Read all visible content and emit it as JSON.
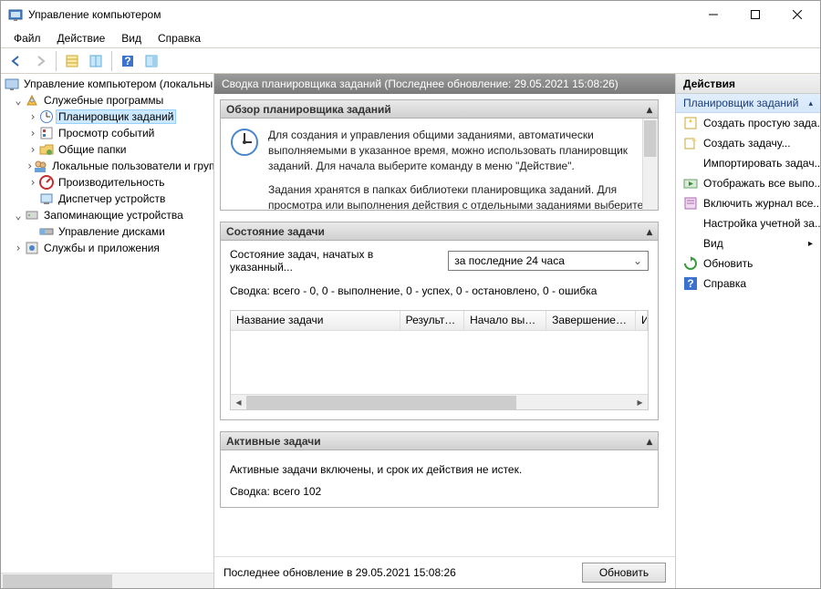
{
  "title": "Управление компьютером",
  "menu": {
    "file": "Файл",
    "action": "Действие",
    "view": "Вид",
    "help": "Справка"
  },
  "tree": {
    "root": "Управление компьютером (локальным",
    "utilities": "Служебные программы",
    "scheduler": "Планировщик заданий",
    "eventviewer": "Просмотр событий",
    "sharedfolders": "Общие папки",
    "localusers": "Локальные пользователи и группы",
    "performance": "Производительность",
    "devicemgr": "Диспетчер устройств",
    "storage": "Запоминающие устройства",
    "diskmgmt": "Управление дисками",
    "services": "Службы и приложения"
  },
  "mid": {
    "header": "Сводка планировщика заданий (Последнее обновление: 29.05.2021 15:08:26)",
    "overview_title": "Обзор планировщика заданий",
    "overview_p1": "Для создания и управления общими заданиями, автоматически выполняемыми в указанное время, можно использовать планировщик заданий. Для начала выберите команду в меню \"Действие\".",
    "overview_p2": "Задания хранятся в папках библиотеки планировщика заданий. Для просмотра или выполнения действия с отдельными заданиями выберите задание в библиотеке планировщика заданий и щелкните команду в меню",
    "status_title": "Состояние задачи",
    "status_label": "Состояние задач, начатых в указанный...",
    "status_select": "за последние 24 часа",
    "status_summary": "Сводка: всего - 0, 0 - выполнение, 0 - успех, 0 - остановлено, 0 - ошибка",
    "cols": {
      "name": "Название задачи",
      "result": "Результат...",
      "start": "Начало выпо...",
      "end": "Завершение в...",
      "idx": "И"
    },
    "active_title": "Активные задачи",
    "active_desc": "Активные задачи включены, и срок их действия не истек.",
    "active_summary": "Сводка: всего 102",
    "lastupdate": "Последнее обновление в 29.05.2021 15:08:26",
    "refresh_btn": "Обновить"
  },
  "actions": {
    "header": "Действия",
    "section": "Планировщик заданий",
    "items": {
      "create_basic": "Создать простую зада...",
      "create_task": "Создать задачу...",
      "import_task": "Импортировать задач...",
      "show_running": "Отображать все выпо...",
      "enable_history": "Включить журнал все...",
      "atconfig": "Настройка учетной за...",
      "view": "Вид",
      "refresh": "Обновить",
      "help": "Справка"
    }
  }
}
